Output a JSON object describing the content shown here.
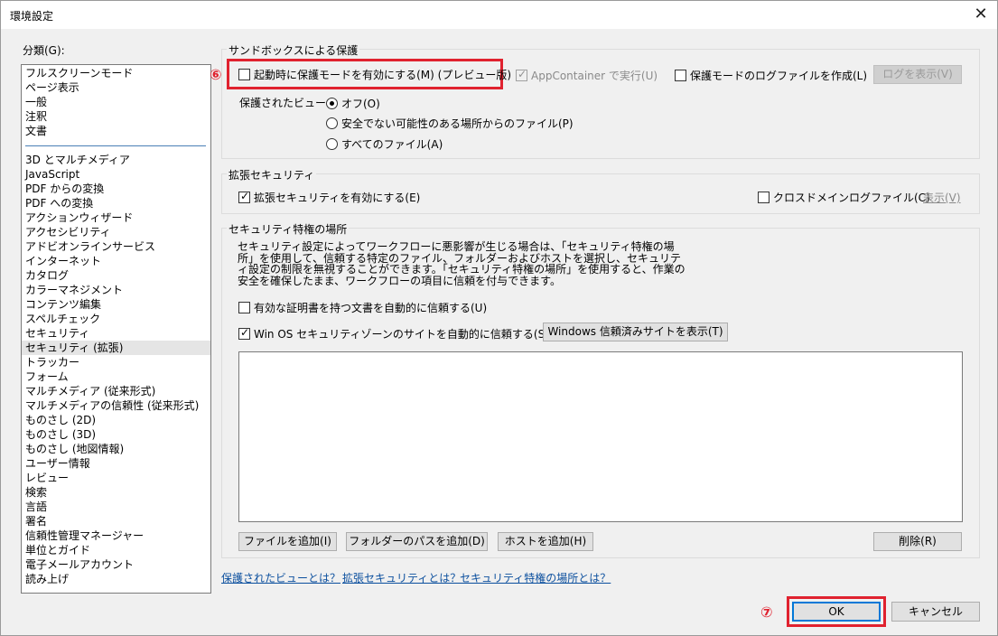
{
  "window": {
    "title": "環境設定",
    "close_glyph": "✕"
  },
  "categories": {
    "label": "分類(G):",
    "group1": [
      "フルスクリーンモード",
      "ページ表示",
      "一般",
      "注釈",
      "文書"
    ],
    "group2": [
      "3D とマルチメディア",
      "JavaScript",
      "PDF からの変換",
      "PDF への変換",
      "アクションウィザード",
      "アクセシビリティ",
      "アドビオンラインサービス",
      "インターネット",
      "カタログ",
      "カラーマネジメント",
      "コンテンツ編集",
      "スペルチェック",
      "セキュリティ",
      "セキュリティ (拡張)",
      "トラッカー",
      "フォーム",
      "マルチメディア (従来形式)",
      "マルチメディアの信頼性 (従来形式)",
      "ものさし (2D)",
      "ものさし (3D)",
      "ものさし (地図情報)",
      "ユーザー情報",
      "レビュー",
      "検索",
      "言語",
      "署名",
      "信頼性管理マネージャー",
      "単位とガイド",
      "電子メールアカウント",
      "読み上げ"
    ],
    "selected": "セキュリティ (拡張)"
  },
  "sandbox": {
    "title": "サンドボックスによる保護",
    "protected_mode_label": "起動時に保護モードを有効にする(M) (プレビュー版)",
    "protected_mode_checked": false,
    "appcontainer_label": "AppContainer で実行(U)",
    "appcontainer_checked": true,
    "log_file_label": "保護モードのログファイルを作成(L)",
    "log_file_checked": false,
    "show_log_label": "ログを表示(V)",
    "protected_view_label": "保護されたビュー",
    "protected_view_options": [
      "オフ(O)",
      "安全でない可能性のある場所からのファイル(P)",
      "すべてのファイル(A)"
    ],
    "protected_view_selected": 0
  },
  "enhanced": {
    "title": "拡張セキュリティ",
    "enable_label": "拡張セキュリティを有効にする(E)",
    "enable_checked": true,
    "crossdomain_label": "クロスドメインログファイル(C)",
    "crossdomain_checked": false,
    "show_label": "表示(V)"
  },
  "privileged": {
    "title": "セキュリティ特権の場所",
    "description": "セキュリティ設定によってワークフローに悪影響が生じる場合は、「セキュリティ特権の場所」を使用して、信頼する特定のファイル、フォルダーおよびホストを選択し、セキュリティ設定の制限を無視することができます。「セキュリティ特権の場所」を使用すると、作業の安全を確保したまま、ワークフローの項目に信頼を付与できます。",
    "cert_label": "有効な証明書を持つ文書を自動的に信頼する(U)",
    "cert_checked": false,
    "winos_label": "Win OS セキュリティゾーンのサイトを自動的に信頼する(S)",
    "winos_checked": true,
    "show_trusted_label": "Windows 信頼済みサイトを表示(T)",
    "add_file_label": "ファイルを追加(I)",
    "add_folder_label": "フォルダーのパスを追加(D)",
    "add_host_label": "ホストを追加(H)",
    "delete_label": "削除(R)"
  },
  "help_links": [
    "保護されたビューとは？",
    "拡張セキュリティとは？",
    "セキュリティ特権の場所とは？"
  ],
  "footer": {
    "ok_label": "OK",
    "cancel_label": "キャンセル"
  },
  "annotations": {
    "marker6": "⑥",
    "marker7": "⑦",
    "color": "#e0222f"
  }
}
